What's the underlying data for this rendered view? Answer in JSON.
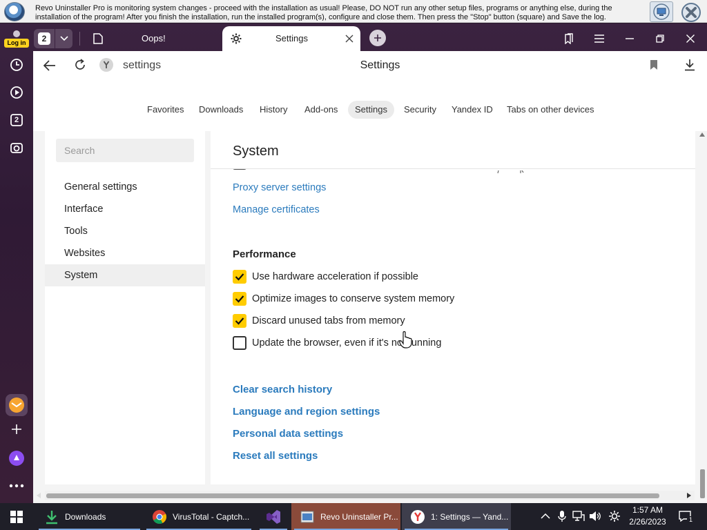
{
  "revo_bar": {
    "text": "Revo Uninstaller Pro is monitoring system changes - proceed with the installation as usual! Please, DO NOT run any other setup files, programs or anything else, during the installation of the program! After you finish the installation, run the installed program(s), configure and close them. Then press the \"Stop\" button (square) and Save the log."
  },
  "rail": {
    "login_label": "Log in",
    "bookmark_count": "2"
  },
  "tabs": {
    "count": "2",
    "items": [
      {
        "label": "Oops!"
      },
      {
        "label": "Settings"
      }
    ]
  },
  "toolbar": {
    "address": "settings",
    "page_title": "Settings"
  },
  "settings_nav": {
    "items": [
      "Favorites",
      "Downloads",
      "History",
      "Add-ons",
      "Settings",
      "Security",
      "Yandex ID",
      "Tabs on other devices"
    ],
    "active": "Settings"
  },
  "sidebar": {
    "search_placeholder": "Search",
    "items": [
      "General settings",
      "Interface",
      "Tools",
      "Websites",
      "System"
    ],
    "active": "System"
  },
  "main": {
    "title": "System",
    "links": {
      "proxy": "Proxy server settings",
      "certificates": "Manage certificates"
    },
    "performance": {
      "heading": "Performance",
      "options": [
        {
          "label": "Use hardware acceleration if possible",
          "checked": true
        },
        {
          "label": "Optimize images to conserve system memory",
          "checked": true
        },
        {
          "label": "Discard unused tabs from memory",
          "checked": true
        },
        {
          "label": "Update the browser, even if it's not running",
          "checked": false
        }
      ]
    },
    "actions": [
      "Clear search history",
      "Language and region settings",
      "Personal data settings",
      "Reset all settings"
    ]
  },
  "taskbar": {
    "items": [
      {
        "label": "Downloads",
        "icon": "download-arrow-icon"
      },
      {
        "label": "VirusTotal - Captch...",
        "icon": "chrome-icon"
      },
      {
        "label": "",
        "icon": "visual-studio-icon"
      },
      {
        "label": "Revo Uninstaller Pr...",
        "icon": "revo-icon"
      },
      {
        "label": "1: Settings — Yand...",
        "icon": "yandex-icon"
      }
    ],
    "time": "1:57 AM",
    "date": "2/26/2023",
    "notification_count": "1"
  },
  "colors": {
    "accent": "#ffcc00",
    "link": "#2b7bbd",
    "browser_frame": "#3b2340"
  }
}
